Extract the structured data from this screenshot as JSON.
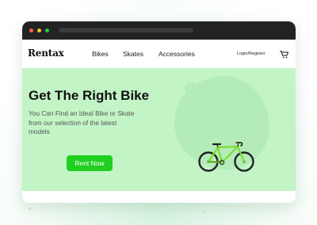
{
  "brand": {
    "logo": "Rentax"
  },
  "nav": {
    "links": [
      {
        "label": "Bikes"
      },
      {
        "label": "Skates"
      },
      {
        "label": "Accessories"
      }
    ],
    "login_label": "Login/Register",
    "cart_icon": "shopping-cart-icon"
  },
  "hero": {
    "title": "Get The Right Bike",
    "subtitle": "You Can Find an Ideal Bike or Skate from our selection of the latest models",
    "cta_label": "Rent Now",
    "image_icon": "road-bike-illustration"
  },
  "colors": {
    "hero_background": "#c3f4c6",
    "accent": "#21cf21",
    "titlebar": "#222322"
  }
}
